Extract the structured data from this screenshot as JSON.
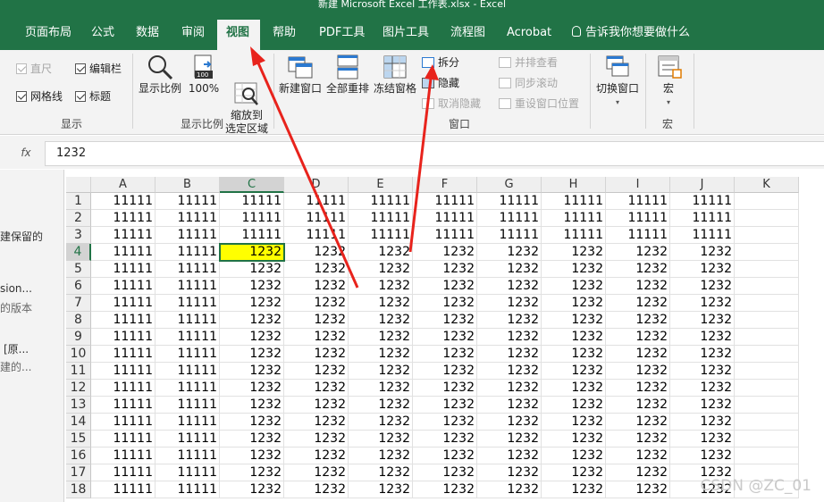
{
  "window": {
    "title": "新建 Microsoft Excel 工作表.xlsx  -  Excel"
  },
  "tabs": [
    {
      "label": "页面布局"
    },
    {
      "label": "公式"
    },
    {
      "label": "数据"
    },
    {
      "label": "审阅"
    },
    {
      "label": "视图"
    },
    {
      "label": "帮助"
    },
    {
      "label": "PDF工具"
    },
    {
      "label": "图片工具"
    },
    {
      "label": "流程图"
    },
    {
      "label": "Acrobat"
    },
    {
      "label": "告诉我你想要做什么"
    }
  ],
  "ribbon": {
    "show": {
      "ruler": "直尺",
      "formula_bar": "编辑栏",
      "gridlines": "网格线",
      "headings": "标题",
      "group_label": "显示"
    },
    "zoom": {
      "zoom": "显示比例",
      "zoom100": "100%",
      "zoom_selection": "缩放到\n选定区域",
      "zoom100_icon": "100",
      "group_label": "显示比例"
    },
    "window": {
      "new_window": "新建窗口",
      "arrange_all": "全部重排",
      "freeze_panes": "冻结窗格",
      "split": "拆分",
      "hide": "隐藏",
      "unhide": "取消隐藏",
      "side_by_side": "并排查看",
      "sync_scroll": "同步滚动",
      "reset_position": "重设窗口位置",
      "switch_windows": "切换窗口",
      "group_label": "窗口"
    },
    "macros": {
      "macros": "宏",
      "group_label": "宏"
    }
  },
  "formula": {
    "fx": "fx",
    "value": "1232"
  },
  "side_panel": {
    "items": [
      "建保留的",
      "sion...",
      "的版本",
      "[原...",
      "建的..."
    ]
  },
  "grid": {
    "columns": [
      "A",
      "B",
      "C",
      "D",
      "E",
      "F",
      "G",
      "H",
      "I",
      "J",
      "K"
    ],
    "rows": [
      [
        "11111",
        "11111",
        "11111",
        "11111",
        "11111",
        "11111",
        "11111",
        "11111",
        "11111",
        "11111"
      ],
      [
        "11111",
        "11111",
        "11111",
        "11111",
        "11111",
        "11111",
        "11111",
        "11111",
        "11111",
        "11111"
      ],
      [
        "11111",
        "11111",
        "11111",
        "11111",
        "11111",
        "11111",
        "11111",
        "11111",
        "11111",
        "11111"
      ],
      [
        "11111",
        "11111",
        "1232",
        "1232",
        "1232",
        "1232",
        "1232",
        "1232",
        "1232",
        "1232"
      ],
      [
        "11111",
        "11111",
        "1232",
        "1232",
        "1232",
        "1232",
        "1232",
        "1232",
        "1232",
        "1232"
      ],
      [
        "11111",
        "11111",
        "1232",
        "1232",
        "1232",
        "1232",
        "1232",
        "1232",
        "1232",
        "1232"
      ],
      [
        "11111",
        "11111",
        "1232",
        "1232",
        "1232",
        "1232",
        "1232",
        "1232",
        "1232",
        "1232"
      ],
      [
        "11111",
        "11111",
        "1232",
        "1232",
        "1232",
        "1232",
        "1232",
        "1232",
        "1232",
        "1232"
      ],
      [
        "11111",
        "11111",
        "1232",
        "1232",
        "1232",
        "1232",
        "1232",
        "1232",
        "1232",
        "1232"
      ],
      [
        "11111",
        "11111",
        "1232",
        "1232",
        "1232",
        "1232",
        "1232",
        "1232",
        "1232",
        "1232"
      ],
      [
        "11111",
        "11111",
        "1232",
        "1232",
        "1232",
        "1232",
        "1232",
        "1232",
        "1232",
        "1232"
      ],
      [
        "11111",
        "11111",
        "1232",
        "1232",
        "1232",
        "1232",
        "1232",
        "1232",
        "1232",
        "1232"
      ],
      [
        "11111",
        "11111",
        "1232",
        "1232",
        "1232",
        "1232",
        "1232",
        "1232",
        "1232",
        "1232"
      ],
      [
        "11111",
        "11111",
        "1232",
        "1232",
        "1232",
        "1232",
        "1232",
        "1232",
        "1232",
        "1232"
      ],
      [
        "11111",
        "11111",
        "1232",
        "1232",
        "1232",
        "1232",
        "1232",
        "1232",
        "1232",
        "1232"
      ],
      [
        "11111",
        "11111",
        "1232",
        "1232",
        "1232",
        "1232",
        "1232",
        "1232",
        "1232",
        "1232"
      ],
      [
        "11111",
        "11111",
        "1232",
        "1232",
        "1232",
        "1232",
        "1232",
        "1232",
        "1232",
        "1232"
      ],
      [
        "11111",
        "11111",
        "1232",
        "1232",
        "1232",
        "1232",
        "1232",
        "1232",
        "1232",
        "1232"
      ]
    ],
    "active_cell": "C4",
    "active_fill": "#ffff00"
  },
  "colors": {
    "excel_green": "#217346",
    "annotation_red": "#e8231c"
  },
  "watermark": "CSDN @ZC_01"
}
